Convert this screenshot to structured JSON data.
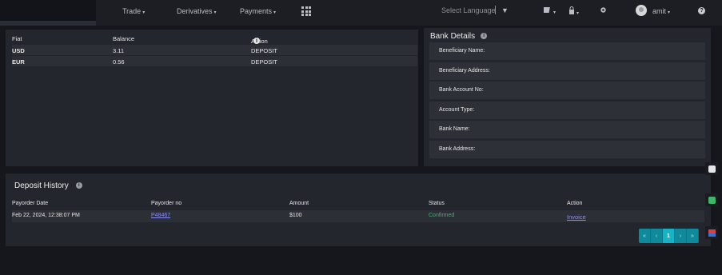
{
  "nav": {
    "items": [
      "Trade",
      "Derivatives",
      "Payments"
    ],
    "language": "Select Language",
    "username": "amit",
    "help": "?"
  },
  "fiat": {
    "headers": [
      "Fiat",
      "Balance",
      "Action"
    ],
    "rows": [
      {
        "currency": "USD",
        "balance": "3.11",
        "action": "DEPOSIT"
      },
      {
        "currency": "EUR",
        "balance": "0.56",
        "action": "DEPOSIT"
      }
    ]
  },
  "bank": {
    "title": "Bank Details",
    "fields": [
      "Beneficiary Name:",
      "Beneficiary Address:",
      "Bank Account No:",
      "Account Type:",
      "Bank Name:",
      "Bank Address:"
    ]
  },
  "history": {
    "title": "Deposit History",
    "headers": [
      "Payorder Date",
      "Payorder no",
      "Amount",
      "Status",
      "Action"
    ],
    "rows": [
      {
        "date": "Feb 22, 2024, 12:38:07 PM",
        "payorder_no": "P48467",
        "amount": "$100",
        "status": "Confirmed",
        "action": "Invoice"
      }
    ]
  },
  "pagination": {
    "first": "«",
    "prev": "‹",
    "current": "1",
    "next": "›",
    "last": "»"
  },
  "icons": {
    "apps": "grid-icon",
    "language_dropdown": "triangle-down-icon",
    "wallet": "wallet-icon",
    "lock": "lock-icon",
    "settings": "gear-icon",
    "info": "info-icon"
  },
  "colors": {
    "accent": "#16b3c6",
    "confirmed": "#3fb56a",
    "link": "#8c8ff2"
  }
}
